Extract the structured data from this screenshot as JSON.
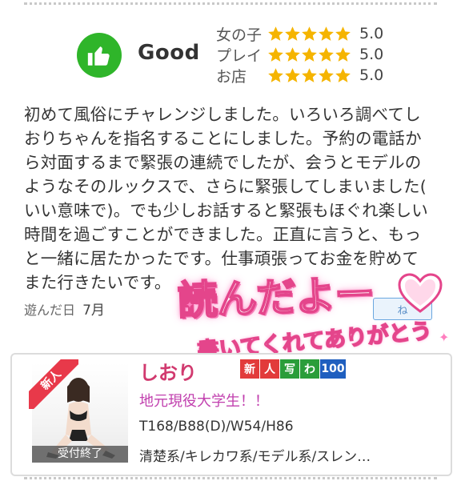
{
  "rating": {
    "overall_label": "Good",
    "overall_icon": "thumbs-up-icon",
    "accent_color": "#2fb52a",
    "star_color": "#f5b400",
    "rows": [
      {
        "label": "女の子",
        "stars": 5,
        "value": "5.0"
      },
      {
        "label": "プレイ",
        "stars": 5,
        "value": "5.0"
      },
      {
        "label": "お店",
        "stars": 5,
        "value": "5.0"
      }
    ]
  },
  "review": {
    "text": "初めて風俗にチャレンジしました。いろいろ調べてし\nおりちゃんを指名することにしました。予約の電話か\nら対面するまで緊張の連続でしたが、会うとモデルの\nようなそのルックスで、さらに緊張してしまいました(\nいい意味で)。でも少しお話すると緊張もほぐれ楽しい\n時間を過ごすことができました。正直に言うと、もっ\nと一緒に居たかったです。仕事頑張ってお金を貯めて\nまた行きたいです。",
    "visit_label": "遊んだ日",
    "visit_month": "7月",
    "like_button_label": "ね"
  },
  "stamp": {
    "main_text": "読んだよー",
    "sub_text": "書いてくれてありがとう",
    "color": "#e4458b"
  },
  "profile": {
    "name": "しおり",
    "ribbon_label": "新人",
    "status_label": "受付終了",
    "badges": [
      {
        "text": "新",
        "color": "#e23b3b"
      },
      {
        "text": "人",
        "color": "#e23b3b"
      },
      {
        "text": "写",
        "color": "#2a9d3a"
      },
      {
        "text": "わ",
        "color": "#2a9d3a"
      },
      {
        "text": "100",
        "color": "#1f5fbf"
      }
    ],
    "catch_copy": "地元現役大学生！！",
    "measurements": "T168/B88(D)/W54/H86",
    "tags": "清楚系/キレカワ系/モデル系/スレン…"
  }
}
